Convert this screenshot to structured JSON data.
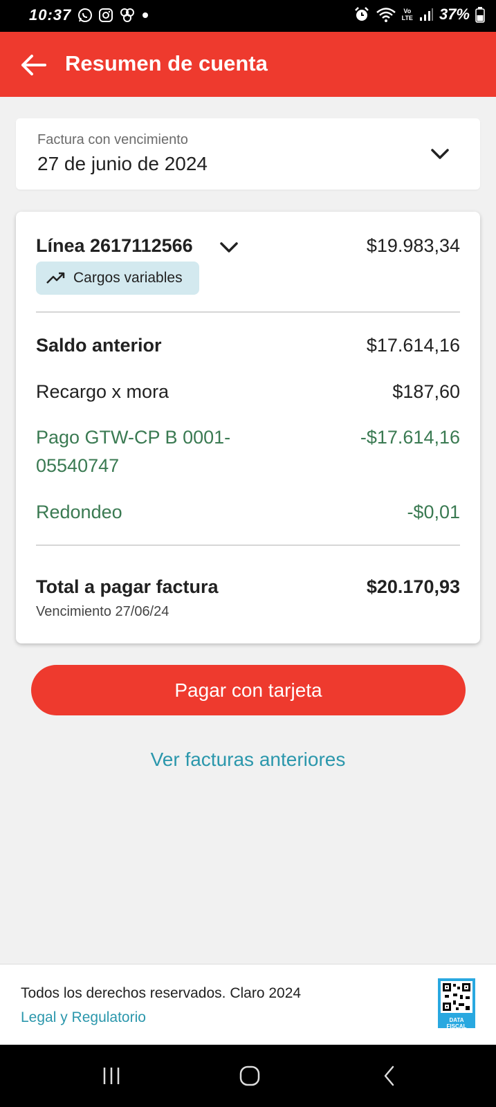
{
  "status_bar": {
    "time": "10:37",
    "left_icons": [
      "whatsapp-icon",
      "instagram-icon",
      "pinwheel-icon",
      "dot-icon"
    ],
    "right_icons": [
      "alarm-icon",
      "wifi-icon",
      "volte-icon",
      "signal-icon",
      "battery-icon"
    ],
    "network_label_top": "Vo",
    "network_label_bottom": "LTE",
    "battery": "37%"
  },
  "header": {
    "title": "Resumen de cuenta",
    "background_color": "#ee3a2e"
  },
  "invoice_selector": {
    "label": "Factura con vencimiento",
    "value": "27 de junio de 2024"
  },
  "summary": {
    "line": {
      "title": "Línea 2617112566",
      "amount": "$19.983,34",
      "badge": "Cargos variables"
    },
    "rows": [
      {
        "label": "Saldo anterior",
        "value": "$17.614,16"
      },
      {
        "label": "Recargo x mora",
        "value": "$187,60"
      },
      {
        "label_line1": "Pago GTW-CP B 0001-",
        "label_line2": "05540747",
        "value": "-$17.614,16"
      },
      {
        "label": "Redondeo",
        "value": "-$0,01"
      }
    ],
    "total": {
      "label": "Total a pagar factura",
      "value": "$20.170,93",
      "due": "Vencimiento 27/06/24"
    },
    "credit_color": "#3a7a52"
  },
  "actions": {
    "pay_label": "Pagar con tarjeta",
    "previous_label": "Ver facturas anteriores",
    "link_color": "#2b97ac"
  },
  "footer": {
    "copyright": "Todos los derechos reservados. Claro 2024",
    "legal_link": "Legal y Regulatorio",
    "datafiscal_line1": "DATA",
    "datafiscal_line2": "FISCAL"
  },
  "nav_bar": {
    "buttons": [
      "recent-apps-icon",
      "home-icon",
      "back-nav-icon"
    ]
  }
}
